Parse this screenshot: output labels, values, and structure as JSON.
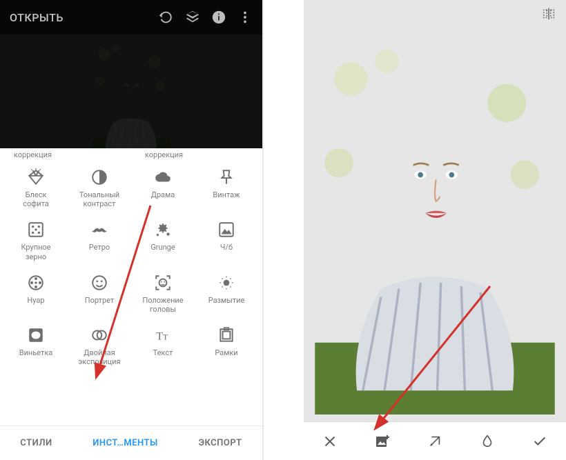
{
  "left": {
    "appbar": {
      "title": "ОТКРЫТЬ"
    },
    "cut_row": [
      "коррекция",
      "",
      "коррекция",
      ""
    ],
    "tools": [
      {
        "name": "glamour-glow",
        "label": "Блеск\nсофита",
        "icon": "diamond-icon"
      },
      {
        "name": "tonal-contrast",
        "label": "Тональный\nконтраст",
        "icon": "half-circle-icon"
      },
      {
        "name": "drama",
        "label": "Драма",
        "icon": "cloud-icon"
      },
      {
        "name": "vintage",
        "label": "Винтаж",
        "icon": "pin-icon"
      },
      {
        "name": "grainy-film",
        "label": "Крупное\nзерно",
        "icon": "dice-icon"
      },
      {
        "name": "retrolux",
        "label": "Ретро",
        "icon": "mustache-icon"
      },
      {
        "name": "grunge",
        "label": "Grunge",
        "icon": "splat-icon"
      },
      {
        "name": "bw",
        "label": "Ч/б",
        "icon": "mountain-icon"
      },
      {
        "name": "noir",
        "label": "Нуар",
        "icon": "reel-icon"
      },
      {
        "name": "portrait",
        "label": "Портрет",
        "icon": "face-smile-icon"
      },
      {
        "name": "head-pose",
        "label": "Положение\nголовы",
        "icon": "face-scan-icon"
      },
      {
        "name": "lens-blur",
        "label": "Размытие",
        "icon": "blur-icon"
      },
      {
        "name": "vignette",
        "label": "Виньетка",
        "icon": "vignette-icon"
      },
      {
        "name": "double-exposure",
        "label": "Двойная\nэкспозиция",
        "icon": "double-circle-icon"
      },
      {
        "name": "text",
        "label": "Текст",
        "icon": "text-icon"
      },
      {
        "name": "frames",
        "label": "Рамки",
        "icon": "frame-icon"
      }
    ],
    "tabs": {
      "styles": "СТИЛИ",
      "tools": "ИНСТ…МЕНТЫ",
      "export": "ЭКСПОРТ"
    }
  },
  "right": {
    "toolbar": {}
  }
}
